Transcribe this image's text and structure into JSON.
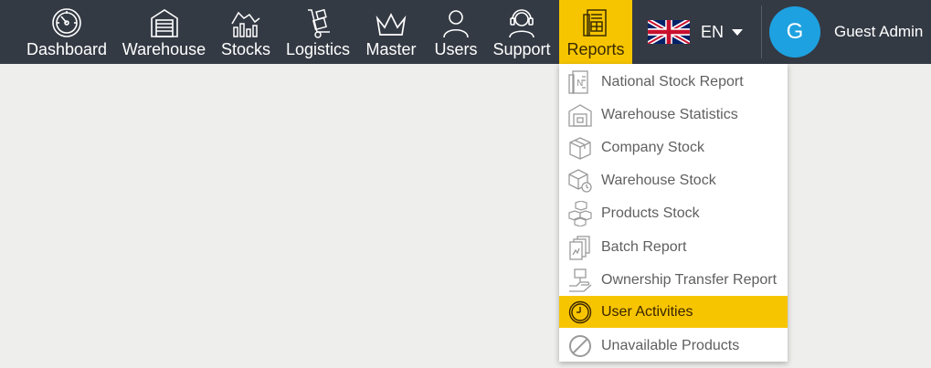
{
  "nav": {
    "items": [
      {
        "label": "Dashboard",
        "icon": "dashboard-gauge-icon"
      },
      {
        "label": "Warehouse",
        "icon": "warehouse-icon"
      },
      {
        "label": "Stocks",
        "icon": "stocks-chart-icon"
      },
      {
        "label": "Logistics",
        "icon": "hand-truck-icon"
      },
      {
        "label": "Master",
        "icon": "crown-icon"
      },
      {
        "label": "Users",
        "icon": "user-icon"
      },
      {
        "label": "Support",
        "icon": "headset-support-icon"
      },
      {
        "label": "Reports",
        "icon": "report-document-icon",
        "active": true
      }
    ]
  },
  "language": {
    "code": "EN",
    "flag": "uk-flag-icon"
  },
  "user": {
    "initial": "G",
    "name": "Guest Admin",
    "avatar_color": "#1ea1e0"
  },
  "reports_menu": {
    "items": [
      {
        "label": "National Stock Report",
        "icon": "national-report-icon"
      },
      {
        "label": "Warehouse Statistics",
        "icon": "warehouse-statistics-icon"
      },
      {
        "label": "Company Stock",
        "icon": "box-icon"
      },
      {
        "label": "Warehouse Stock",
        "icon": "box-search-icon"
      },
      {
        "label": "Products Stock",
        "icon": "stacked-boxes-icon"
      },
      {
        "label": "Batch Report",
        "icon": "batch-documents-icon"
      },
      {
        "label": "Ownership Transfer Report",
        "icon": "hand-box-icon"
      },
      {
        "label": "User Activities",
        "icon": "clock-icon",
        "active": true
      },
      {
        "label": "Unavailable Products",
        "icon": "prohibited-icon"
      }
    ]
  },
  "colors": {
    "topbar": "#343a44",
    "accent": "#f7c500",
    "background": "#eeeeec"
  }
}
